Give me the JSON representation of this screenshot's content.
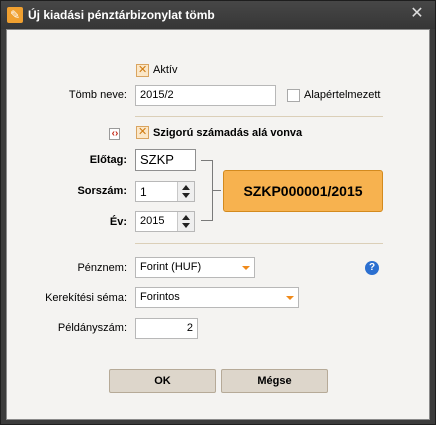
{
  "window": {
    "title": "Új kiadási pénztárbizonylat tömb",
    "close_label": "✕"
  },
  "aktiv": {
    "label": "Aktív",
    "checked": true
  },
  "tomb_neve": {
    "label": "Tömb neve:",
    "value": "2015/2"
  },
  "alapertelmezett": {
    "label": "Alapértelmezett",
    "checked": false
  },
  "szigoru": {
    "label": "Szigorú számadás alá vonva",
    "checked": true
  },
  "elotag": {
    "label": "Előtag:",
    "value": "SZKP"
  },
  "sorszam": {
    "label": "Sorszám:",
    "value": "1"
  },
  "ev": {
    "label": "Év:",
    "value": "2015"
  },
  "generated_code": "SZKP000001/2015",
  "penznem": {
    "label": "Pénznem:",
    "value": "Forint  (HUF)"
  },
  "help_label": "?",
  "kerekitesi_sema": {
    "label": "Kerekítési séma:",
    "value": "Forintos"
  },
  "peldanyszam": {
    "label": "Példányszám:",
    "value": "2"
  },
  "buttons": {
    "ok": "OK",
    "cancel": "Mégse"
  },
  "colors": {
    "accent": "#f7b24f",
    "title_bar": "#3c3c3c",
    "help": "#2b6fd0"
  }
}
